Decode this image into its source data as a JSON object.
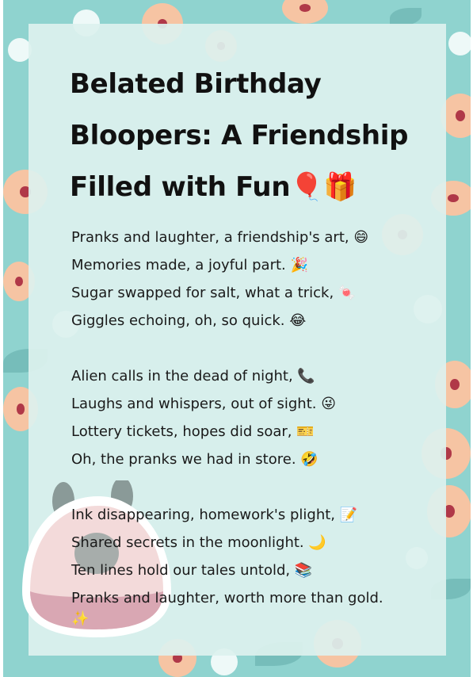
{
  "title": "Belated Birthday Bloopers: A Friendship Filled with Fun🎈🎁",
  "title_lines": [
    "Belated Birthday",
    "Bloopers: A Friendship",
    "Filled with Fun🎈🎁"
  ],
  "stanzas": [
    [
      "Pranks and laughter, a friendship's art, 😄",
      "Memories made, a joyful part. 🎉",
      "Sugar swapped for salt, what a trick, 🍬",
      "Giggles echoing, oh, so quick. 😂"
    ],
    [
      "Alien calls in the dead of night, 📞",
      "Laughs and whispers, out of sight. 😜",
      "Lottery tickets, hopes did soar, 🎫",
      "Oh, the pranks we had in store. 🤣"
    ],
    [
      "Ink disappearing, homework's plight, 📝",
      "Shared secrets in the moonlight. 🌙",
      "Ten lines hold our tales untold, 📚",
      "Pranks and laughter, worth more than gold.",
      "✨"
    ]
  ],
  "colors": {
    "background": "#8fd3cf",
    "panel": "#ddf1ee",
    "flower": "#f6c4a3",
    "text": "#111111"
  }
}
